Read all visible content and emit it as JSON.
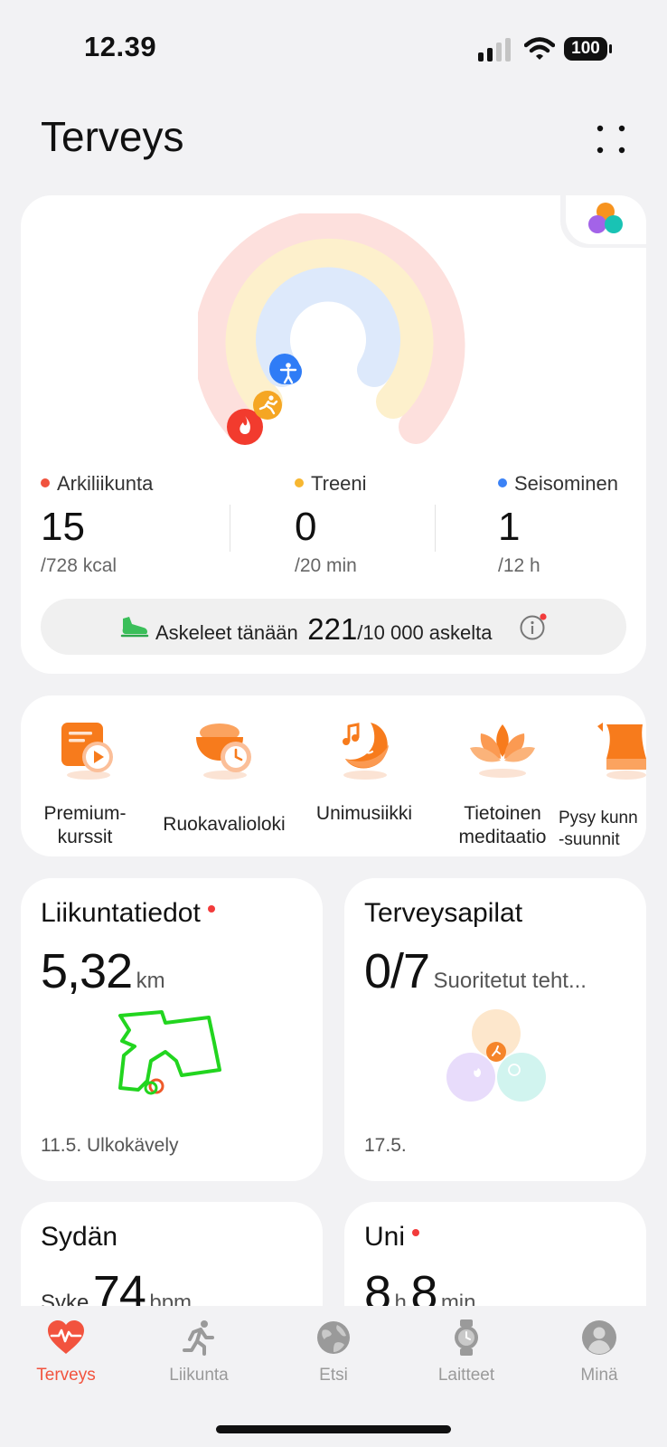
{
  "status": {
    "time": "12.39",
    "battery": "100"
  },
  "header": {
    "title": "Terveys",
    "menu_icon": "grid-dots-icon"
  },
  "rings": {
    "colors": {
      "move": "#f23b2e",
      "exercise": "#f5a623",
      "stand": "#2f7cf6"
    },
    "metrics": [
      {
        "label": "Arkiliikunta",
        "value": "15",
        "goal": "/728 kcal",
        "color": "#f0533e"
      },
      {
        "label": "Treeni",
        "value": "0",
        "goal": "/20 min",
        "color": "#f7b731"
      },
      {
        "label": "Seisominen",
        "value": "1",
        "goal": "/12 h",
        "color": "#3b82f6"
      }
    ],
    "steps": {
      "label": "Askeleet tänään",
      "value": "221",
      "goal": "/10 000 askelta"
    }
  },
  "services": [
    {
      "label": "Premium-\nkurssit",
      "icon": "course-play-icon"
    },
    {
      "label": "Ruokavalioloki",
      "icon": "food-bowl-icon"
    },
    {
      "label": "Unimusiikki",
      "icon": "moon-music-icon"
    },
    {
      "label": "Tietoinen\nmeditaatio",
      "icon": "lotus-icon"
    },
    {
      "label": "Pysy kunn\n-suunnit",
      "icon": "body-shape-icon"
    }
  ],
  "tiles": {
    "activity": {
      "title": "Liikuntatiedot",
      "value": "5,32",
      "unit": "km",
      "footer": "11.5. Ulkokävely"
    },
    "clover": {
      "title": "Terveysapilat",
      "value": "0/7",
      "unit": "Suoritetut teht...",
      "footer": "17.5."
    },
    "heart": {
      "title": "Sydän",
      "prefix": "Syke",
      "value": "74",
      "unit": "bpm"
    },
    "sleep": {
      "title": "Uni",
      "hours": "8",
      "h_unit": "h",
      "minutes": "8",
      "m_unit": "min"
    }
  },
  "tabs": [
    {
      "label": "Terveys",
      "icon": "heart-pulse-icon",
      "active": true
    },
    {
      "label": "Liikunta",
      "icon": "running-icon",
      "active": false
    },
    {
      "label": "Etsi",
      "icon": "globe-icon",
      "active": false
    },
    {
      "label": "Laitteet",
      "icon": "watch-icon",
      "active": false
    },
    {
      "label": "Minä",
      "icon": "profile-icon",
      "active": false
    }
  ]
}
